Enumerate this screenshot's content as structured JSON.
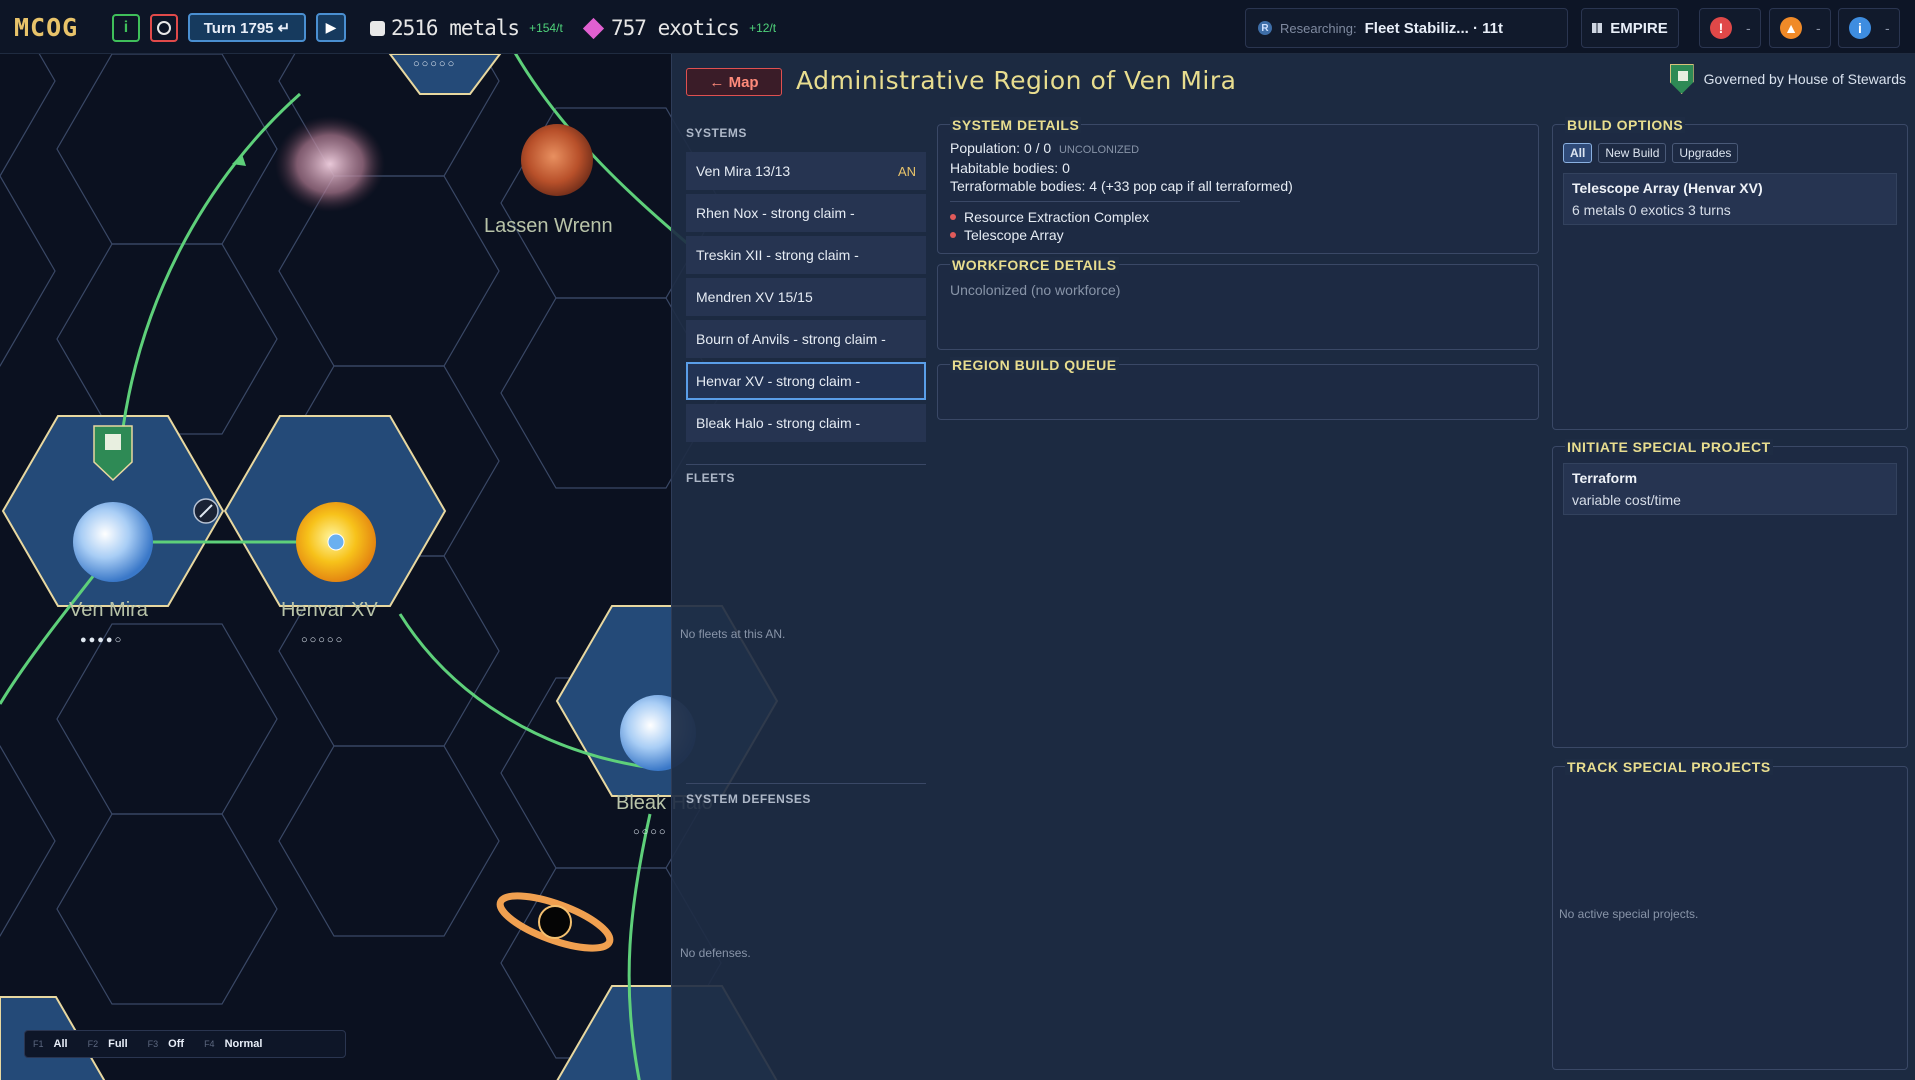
{
  "topbar": {
    "logo": "MCOG",
    "info_label": "i",
    "turn_label": "Turn 1795 ↵",
    "play_label": "▶",
    "metals": {
      "value": "2516 metals",
      "rate": "+154/t"
    },
    "exotics": {
      "value": "757 exotics",
      "rate": "+12/t"
    },
    "research": {
      "label": "Researching:",
      "value": "Fleet Stabiliz... · 11t"
    },
    "empire_label": "EMPIRE",
    "alerts": [
      {
        "icon": "!",
        "value": "-"
      },
      {
        "icon": "▲",
        "value": "-"
      },
      {
        "icon": "i",
        "value": "-"
      }
    ]
  },
  "map": {
    "labels": {
      "lassen": "Lassen Wrenn",
      "venmira": "Ven Mira",
      "henvar": "Henvar XV",
      "bleak": "Bleak Halo"
    },
    "pips": {
      "top": "○○○○○",
      "venmira": "●●●●○",
      "henvar": "○○○○○",
      "bleak": "○○○○"
    },
    "filter": [
      {
        "key": "F1",
        "value": "All"
      },
      {
        "key": "F2",
        "value": "Full"
      },
      {
        "key": "F3",
        "value": "Off"
      },
      {
        "key": "F4",
        "value": "Normal"
      }
    ]
  },
  "panel": {
    "back_label": "← Map",
    "title": "Administrative Region of Ven Mira",
    "governed": "Governed by House of Stewards",
    "systems_heading": "SYSTEMS",
    "systems": [
      {
        "name": "Ven Mira  13/13",
        "tag": "AN"
      },
      {
        "name": "Rhen Nox  - strong claim -",
        "tag": ""
      },
      {
        "name": "Treskin XII  - strong claim -",
        "tag": ""
      },
      {
        "name": "Mendren XV  15/15",
        "tag": ""
      },
      {
        "name": "Bourn of Anvils  - strong claim -",
        "tag": ""
      },
      {
        "name": "Henvar XV  - strong claim -",
        "tag": ""
      },
      {
        "name": "Bleak Halo  - strong claim -",
        "tag": ""
      }
    ],
    "fleets_heading": "FLEETS",
    "fleets_empty": "No fleets at this AN.",
    "defenses_heading": "SYSTEM DEFENSES",
    "defenses_empty": "No defenses.",
    "system_details": {
      "title": "SYSTEM DETAILS",
      "population": "Population: 0 / 0",
      "status": "UNCOLONIZED",
      "habitable": "Habitable bodies: 0",
      "terraformable": "Terraformable bodies: 4 (+33 pop cap if all terraformed)",
      "buildings": [
        "Resource Extraction Complex",
        "Telescope Array"
      ]
    },
    "workforce": {
      "title": "WORKFORCE DETAILS",
      "text": "Uncolonized (no workforce)"
    },
    "queue": {
      "title": "REGION BUILD QUEUE"
    },
    "build_options": {
      "title": "BUILD OPTIONS",
      "tabs": [
        "All",
        "New Build",
        "Upgrades"
      ],
      "item_title": "Telescope Array (Henvar XV)",
      "item_cost": "6 metals  0 exotics  3 turns"
    },
    "special": {
      "title": "INITIATE SPECIAL PROJECT",
      "item_title": "Terraform",
      "item_sub": "variable cost/time"
    },
    "track": {
      "title": "TRACK SPECIAL PROJECTS",
      "empty": "No active special projects."
    }
  },
  "colors": {
    "accent": "#e8dd8f",
    "brand": "#e8c36a",
    "positive": "#4fd27a",
    "danger": "#e04848"
  }
}
